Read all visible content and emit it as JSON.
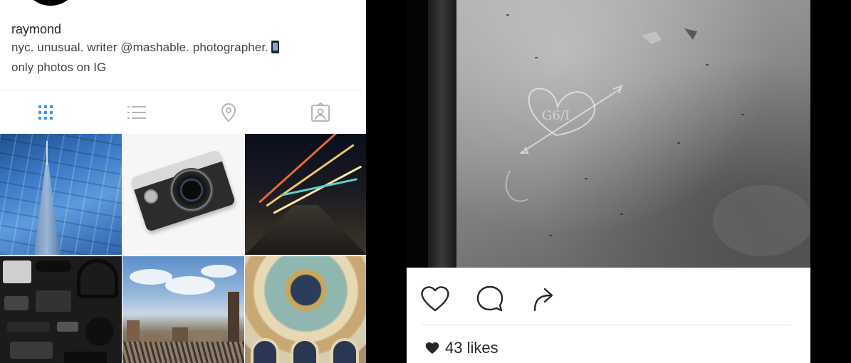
{
  "profile": {
    "username": "raymond",
    "bio_line1": "nyc. unusual. writer @mashable. photographer.",
    "bio_line2": "only photos on IG"
  },
  "tabs": [
    {
      "name": "grid-view",
      "icon": "grid-icon",
      "active": true
    },
    {
      "name": "list-view",
      "icon": "list-icon",
      "active": false
    },
    {
      "name": "map-view",
      "icon": "location-pin-icon",
      "active": false
    },
    {
      "name": "tagged-photos",
      "icon": "tagged-photo-icon",
      "active": false
    }
  ],
  "grid": [
    {
      "subject": "glass skyscraper"
    },
    {
      "subject": "silver and black camera"
    },
    {
      "subject": "night street light trails"
    },
    {
      "subject": "camera gear flat lay"
    },
    {
      "subject": "city skyline and rail yard"
    },
    {
      "subject": "ornate dome ceiling"
    }
  ],
  "post": {
    "likes_text": "43 likes",
    "actions": [
      {
        "name": "like",
        "icon": "heart-icon"
      },
      {
        "name": "comment",
        "icon": "comment-icon"
      },
      {
        "name": "share",
        "icon": "share-arrow-icon"
      }
    ]
  },
  "colors": {
    "active_tab": "#3897f0",
    "inactive_icon": "#b5b5b5",
    "text": "#262626"
  }
}
